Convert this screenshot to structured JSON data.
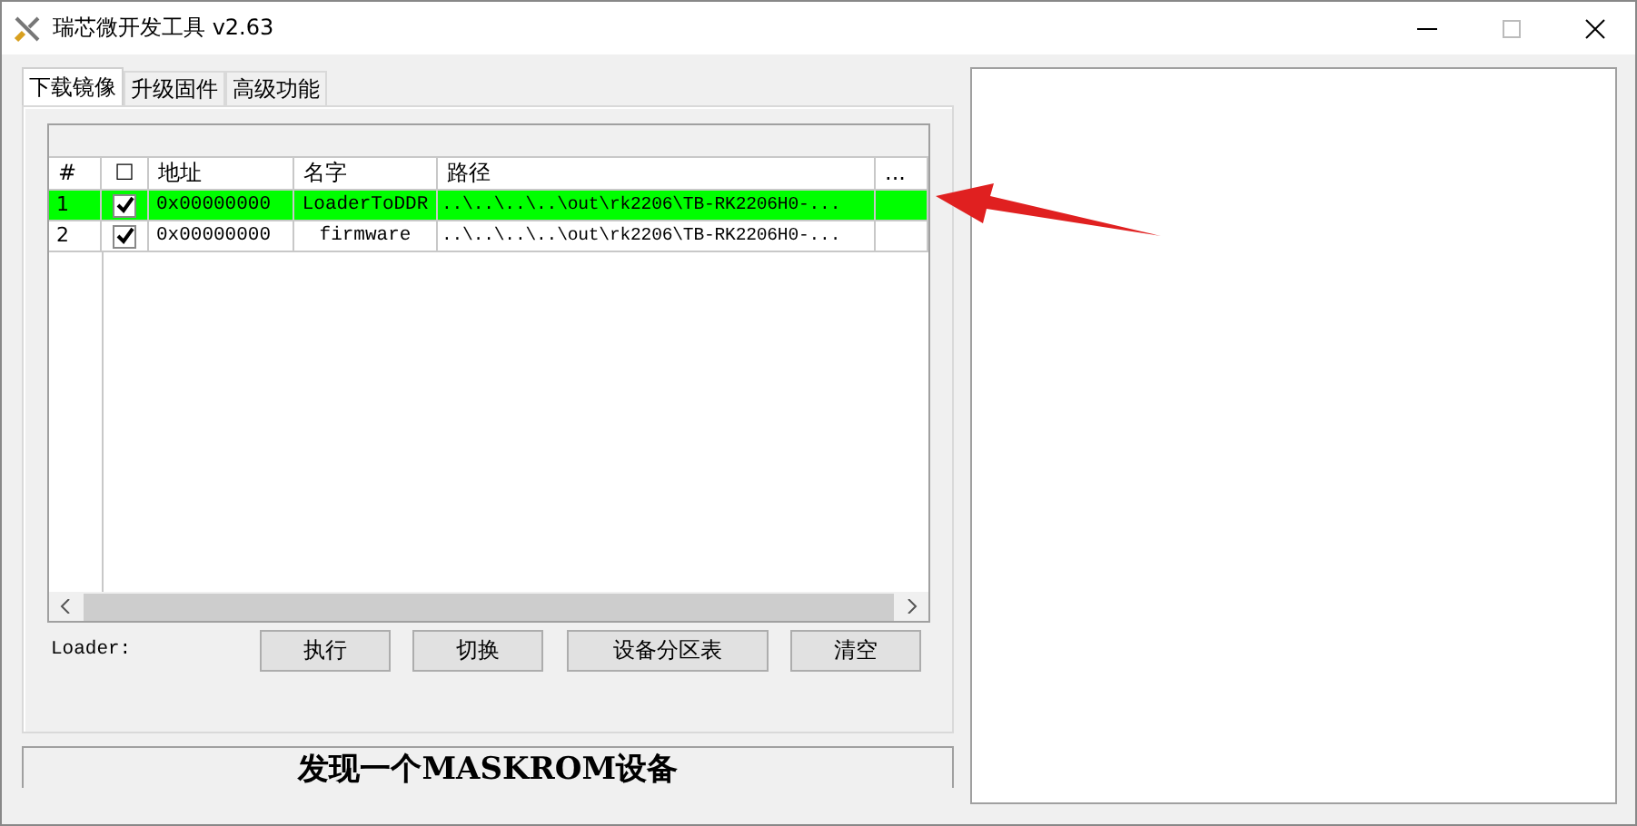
{
  "window": {
    "title": "瑞芯微开发工具 v2.63"
  },
  "tabs": [
    {
      "label": "下载镜像",
      "selected": true
    },
    {
      "label": "升级固件",
      "selected": false
    },
    {
      "label": "高级功能",
      "selected": false
    }
  ],
  "table": {
    "columns": [
      "#",
      "☐",
      "地址",
      "名字",
      "路径",
      "..."
    ],
    "rows": [
      {
        "index": "1",
        "checked": true,
        "selected": true,
        "address": "0x00000000",
        "name": "LoaderToDDR",
        "path": "..\\..\\..\\..\\out\\rk2206\\TB-RK2206H0-..."
      },
      {
        "index": "2",
        "checked": true,
        "selected": false,
        "address": "0x00000000",
        "name": "firmware",
        "path": "..\\..\\..\\..\\out\\rk2206\\TB-RK2206H0-..."
      }
    ]
  },
  "loader_label": "Loader:",
  "buttons": [
    "执行",
    "切换",
    "设备分区表",
    "清空"
  ],
  "status_bar": "发现一个MASKROM设备"
}
